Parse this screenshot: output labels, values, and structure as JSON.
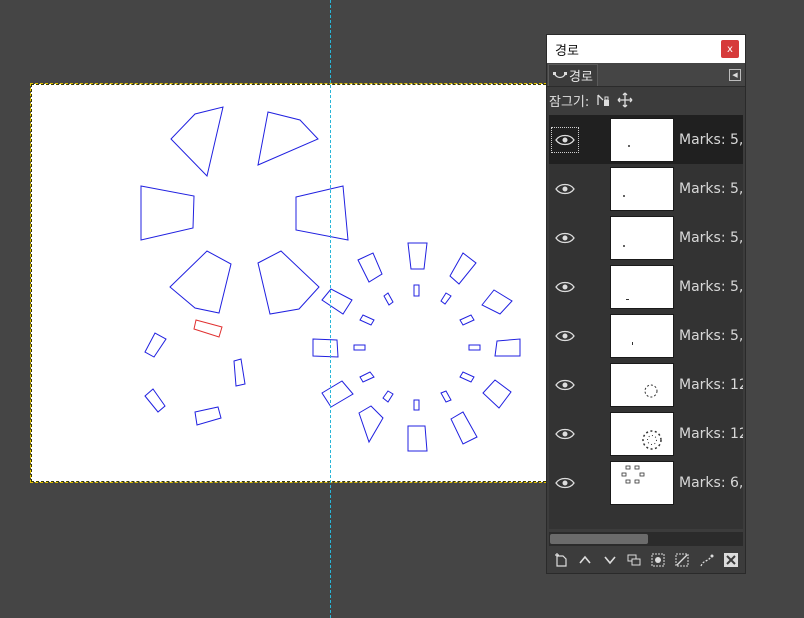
{
  "panel": {
    "title": "경로",
    "close_label": "x",
    "tab_label": "경로",
    "lock_label": "잠그기:"
  },
  "paths": [
    {
      "label": "Marks: 5,",
      "selected": true
    },
    {
      "label": "Marks: 5,",
      "selected": false
    },
    {
      "label": "Marks: 5,",
      "selected": false
    },
    {
      "label": "Marks: 5,",
      "selected": false
    },
    {
      "label": "Marks: 5,",
      "selected": false
    },
    {
      "label": "Marks: 12",
      "selected": false
    },
    {
      "label": "Marks: 12",
      "selected": false
    },
    {
      "label": "Marks: 6,",
      "selected": false
    }
  ],
  "colors": {
    "path_stroke": "#2020e0",
    "active_path_stroke": "#e03030",
    "guide": "#29b6d8",
    "selection": "#e0c000"
  }
}
